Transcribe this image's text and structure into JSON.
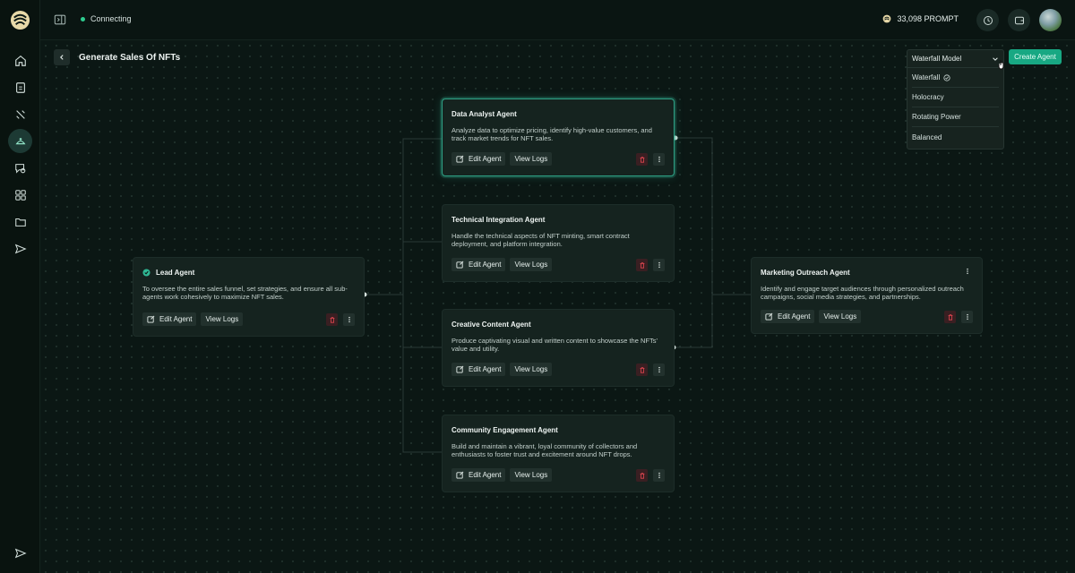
{
  "topbar": {
    "status_text": "Connecting",
    "prompt_balance": "33,098 PROMPT"
  },
  "page": {
    "title": "Generate Sales Of NFTs"
  },
  "model_select": {
    "selected": "Waterfall Model",
    "options": [
      "Waterfall",
      "Holocracy",
      "Rotating Power",
      "Balanced"
    ]
  },
  "create_agent_label": "Create Agent",
  "agents": {
    "lead": {
      "title": "Lead Agent",
      "desc": "To oversee the entire sales funnel, set strategies, and ensure all sub-agents work cohesively to maximize NFT sales."
    },
    "data_analyst": {
      "title": "Data Analyst Agent",
      "desc": "Analyze data to optimize pricing, identify high-value customers, and track market trends for NFT sales."
    },
    "technical": {
      "title": "Technical Integration Agent",
      "desc": "Handle the technical aspects of NFT minting, smart contract deployment, and platform integration."
    },
    "creative": {
      "title": "Creative Content Agent",
      "desc": "Produce captivating visual and written content to showcase the NFTs' value and utility."
    },
    "community": {
      "title": "Community Engagement Agent",
      "desc": "Build and maintain a vibrant, loyal community of collectors and enthusiasts to foster trust and excitement around NFT drops."
    },
    "marketing": {
      "title": "Marketing Outreach Agent",
      "desc": "Identify and engage target audiences through personalized outreach campaigns, social media strategies, and partnerships."
    }
  },
  "buttons": {
    "edit": "Edit Agent",
    "logs": "View Logs"
  },
  "colors": {
    "accent": "#18a883",
    "background": "#0b1714",
    "card": "#15231f",
    "delete": "#e0474f"
  }
}
